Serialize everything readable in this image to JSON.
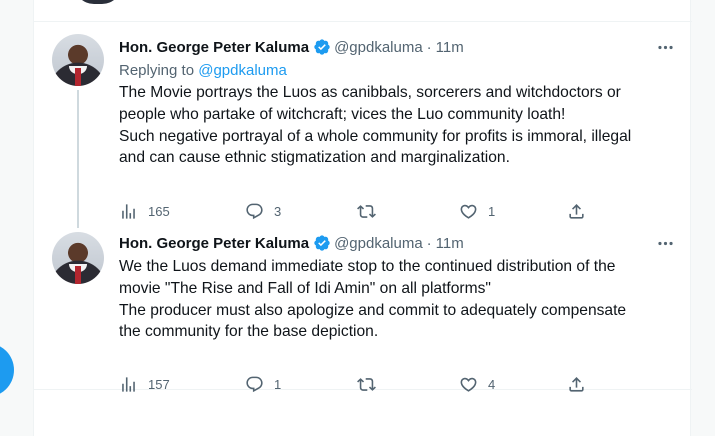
{
  "colors": {
    "accent": "#1d9bf0",
    "text": "#0f1419",
    "muted": "#536471",
    "border": "#eff3f4"
  },
  "tweets": [
    {
      "author": {
        "name": "Hon. George Peter Kaluma",
        "handle": "@gpdkaluma",
        "time": "11m",
        "verified": true
      },
      "replying_prefix": "Replying to",
      "replying_handle": "@gpdkaluma",
      "lines": [
        "The Movie portrays the Luos as canibbals, sorcerers and witchdoctors or",
        "people who partake of witchcraft; vices the Luo community loath!",
        "Such negative portrayal of a whole community for profits is immoral, illegal",
        "and can cause ethnic stigmatization and marginalization."
      ],
      "stats": {
        "views": "165",
        "replies": "3",
        "retweets": "",
        "likes": "1"
      }
    },
    {
      "author": {
        "name": "Hon. George Peter Kaluma",
        "handle": "@gpdkaluma",
        "time": "11m",
        "verified": true
      },
      "lines": [
        "We the Luos demand immediate stop to the continued distribution of the",
        "movie \"The Rise and Fall of Idi Amin\" on all platforms\"",
        "The producer must also apologize and commit to adequately compensate",
        "the community for the base depiction."
      ],
      "stats": {
        "views": "157",
        "replies": "1",
        "retweets": "",
        "likes": "4"
      }
    }
  ],
  "icons": [
    "verified-badge-icon",
    "more-icon",
    "views-icon",
    "reply-icon",
    "retweet-icon",
    "like-icon",
    "share-icon"
  ]
}
